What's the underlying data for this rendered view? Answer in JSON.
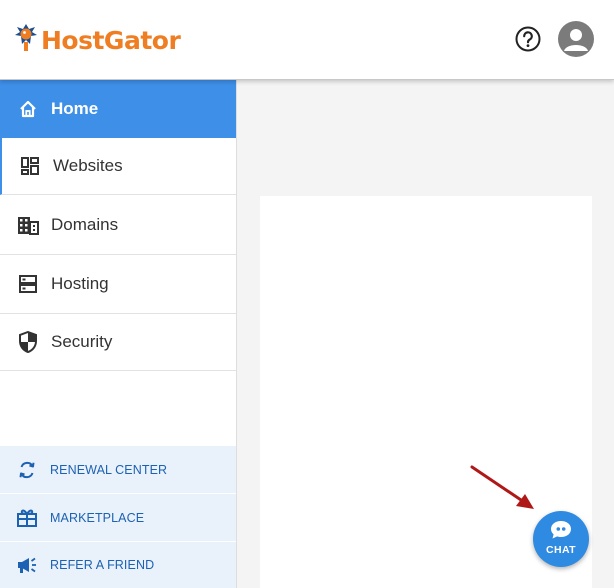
{
  "header": {
    "brand": "HostGator",
    "help_icon": "question-circle-icon",
    "avatar_icon": "user-avatar-icon",
    "brand_color": "#ef7d22"
  },
  "sidebar": {
    "items": [
      {
        "label": "Home",
        "icon": "home-icon",
        "active": true
      },
      {
        "label": "Websites",
        "icon": "dashboard-grid-icon"
      },
      {
        "label": "Domains",
        "icon": "building-icon"
      },
      {
        "label": "Hosting",
        "icon": "server-icon"
      },
      {
        "label": "Security",
        "icon": "shield-icon"
      }
    ],
    "bottom_items": [
      {
        "label": "RENEWAL CENTER",
        "icon": "refresh-icon"
      },
      {
        "label": "MARKETPLACE",
        "icon": "gift-icon"
      },
      {
        "label": "REFER A FRIEND",
        "icon": "megaphone-icon"
      }
    ],
    "active_color": "#3d8fe8"
  },
  "chat": {
    "label": "CHAT",
    "icon": "chat-bubble-icon",
    "color": "#2f8ae2"
  },
  "annotation": {
    "icon": "red-arrow-icon",
    "color": "#b01818"
  }
}
